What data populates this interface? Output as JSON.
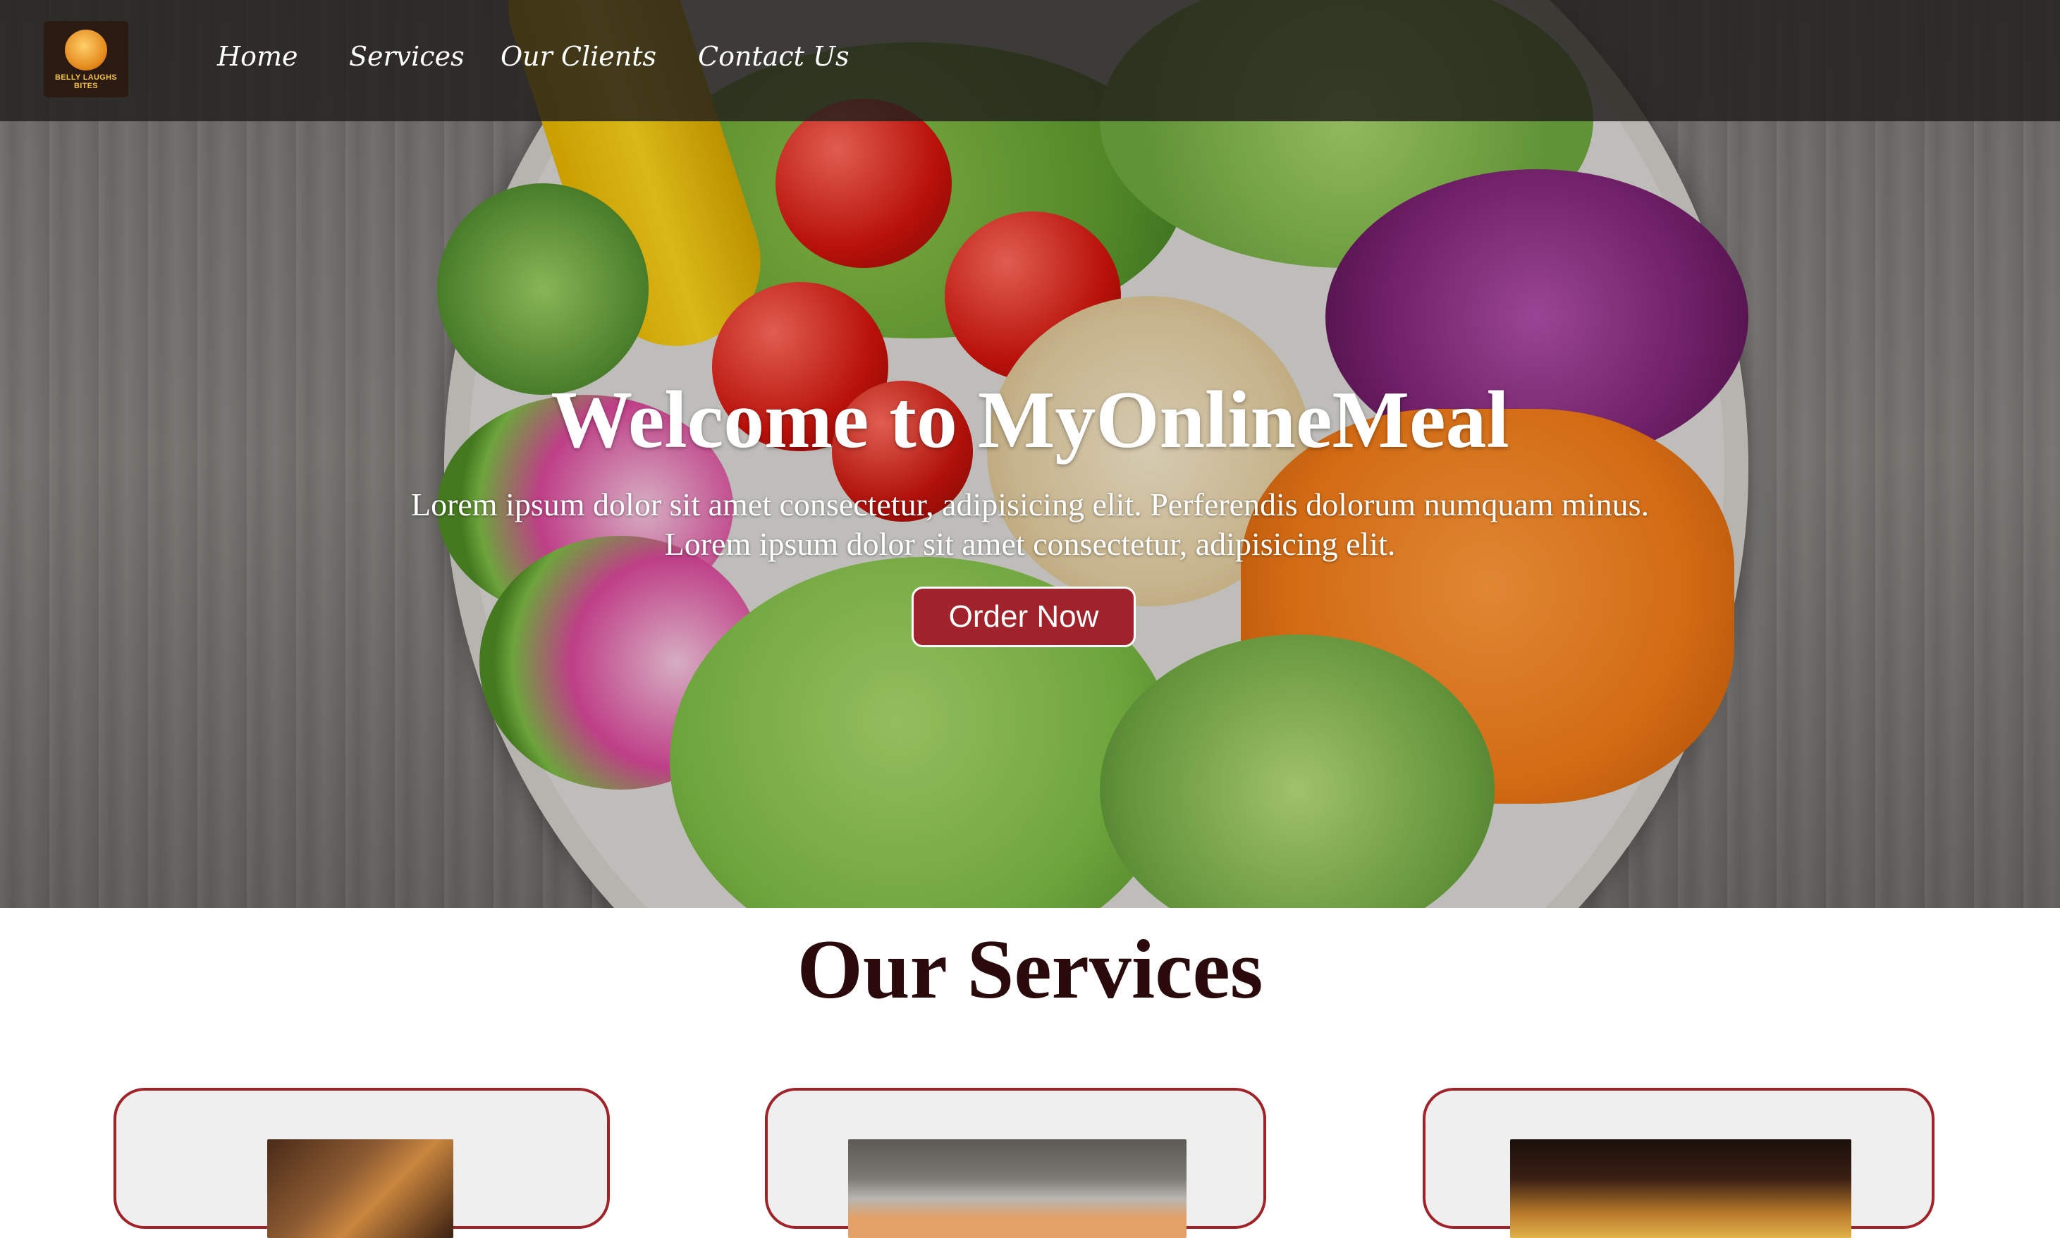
{
  "nav": {
    "logo_text": "BELLY LAUGHS BITES",
    "links": [
      "Home",
      "Services",
      "Our Clients",
      "Contact Us"
    ]
  },
  "hero": {
    "title": "Welcome to MyOnlineMeal",
    "line1": "Lorem ipsum dolor sit amet consectetur, adipisicing elit. Perferendis dolorum numquam minus.",
    "line2": "Lorem ipsum dolor sit amet consectetur, adipisicing elit.",
    "cta": "Order Now"
  },
  "services": {
    "title": "Our Services"
  },
  "colors": {
    "accent": "#a0232b",
    "heading": "#2b0a0c",
    "nav_bg": "#211e1b"
  }
}
